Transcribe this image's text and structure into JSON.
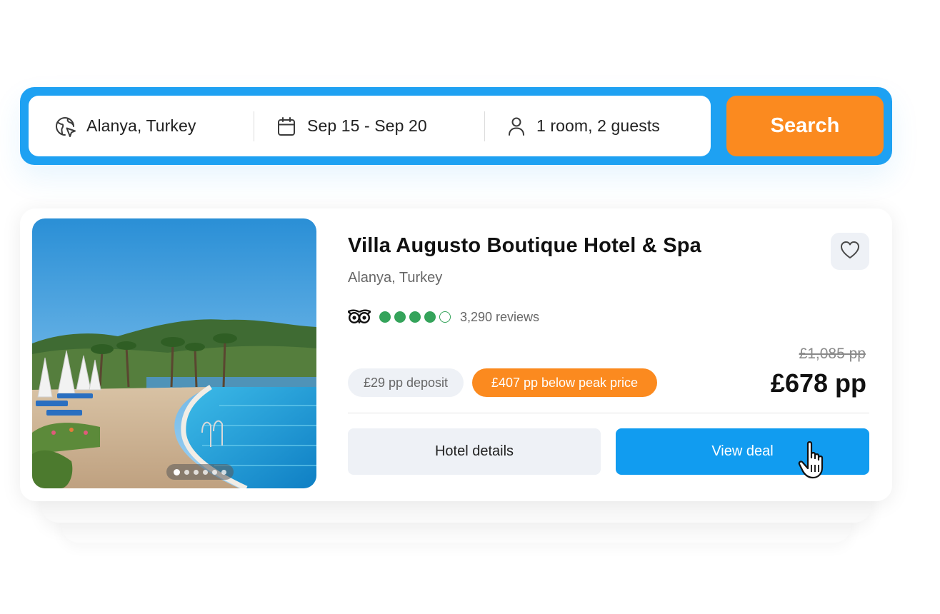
{
  "search": {
    "location": "Alanya, Turkey",
    "dates": "Sep 15 - Sep 20",
    "guests": "1 room, 2 guests",
    "button_label": "Search"
  },
  "hotel": {
    "name": "Villa Augusto Boutique Hotel & Spa",
    "location": "Alanya, Turkey",
    "rating": {
      "bubbles_filled": 4,
      "bubbles_total": 5,
      "reviews": "3,290 reviews"
    },
    "deposit_badge": "£29 pp deposit",
    "peak_badge": "£407 pp below peak price",
    "old_price": "£1,085 pp",
    "price": "£678 pp",
    "details_button": "Hotel details",
    "deal_button": "View deal",
    "photo_carousel": {
      "count": 6,
      "active": 1
    }
  },
  "icons": {
    "location": "globe-pin-icon",
    "dates": "calendar-icon",
    "guests": "user-icon",
    "favorite": "heart-icon",
    "rating_logo": "tripadvisor-owl-icon",
    "cursor": "hand-pointer-icon"
  },
  "colors": {
    "search_bar": "#1ea1f2",
    "search_button": "#fb8a1f",
    "peak_badge": "#fb8a1f",
    "view_deal": "#119cf0",
    "rating_bubble": "#34a35a",
    "neutral_chip": "#eef1f6"
  }
}
